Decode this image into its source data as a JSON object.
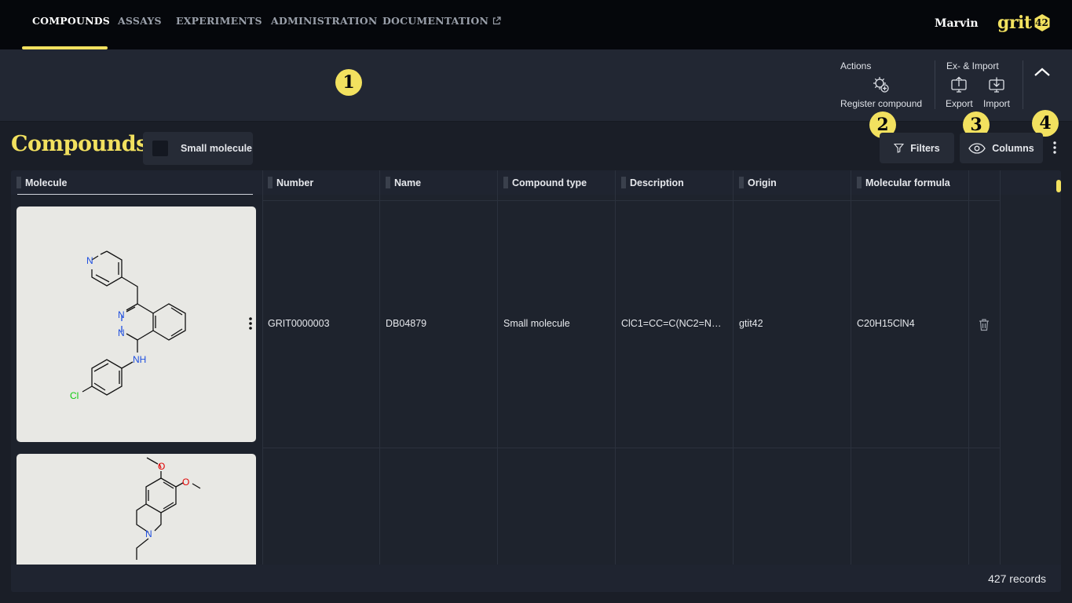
{
  "nav": {
    "items": [
      "COMPOUNDS",
      "ASSAYS",
      "EXPERIMENTS",
      "ADMINISTRATION",
      "DOCUMENTATION"
    ],
    "active": "COMPOUNDS",
    "user": "Marvin",
    "logo_text": "grit",
    "logo_badge": "42"
  },
  "toolbar": {
    "callout1": "1",
    "actions_title": "Actions",
    "register_label": "Register compound",
    "import_title": "Ex- & Import",
    "export_label": "Export",
    "import_label": "Import"
  },
  "header": {
    "title": "Compounds",
    "chip_label": "Small molecule",
    "filters_label": "Filters",
    "columns_label": "Columns",
    "callout2": "2",
    "callout3": "3",
    "callout4": "4"
  },
  "grid": {
    "columns": [
      "Molecule",
      "Number",
      "Name",
      "Compound type",
      "Description",
      "Origin",
      "Molecular formula"
    ],
    "rows": [
      {
        "number": "GRIT0000003",
        "name": "DB04879",
        "compound_type": "Small molecule",
        "description": "ClC1=CC=C(NC2=NN=…",
        "origin": "gtit42",
        "formula": "C20H15ClN4"
      }
    ],
    "atom_labels": {
      "n_pyridine": "N",
      "n1": "N",
      "n2": "N",
      "nh": "NH",
      "cl": "Cl",
      "o1": "O",
      "o2": "O",
      "n3": "N"
    },
    "records": "427 records"
  },
  "colors": {
    "accent": "#f2e15f",
    "bg": "#1a1e27",
    "nav_bg": "#05070b",
    "nitrogen": "#1f4fe0",
    "chlorine": "#10cc10",
    "oxygen": "#e00000"
  },
  "icons": [
    "external-link-icon",
    "register-compound-icon",
    "export-icon",
    "import-icon",
    "chevron-up-icon",
    "filter-icon",
    "eye-icon",
    "kebab-icon",
    "trash-icon"
  ]
}
